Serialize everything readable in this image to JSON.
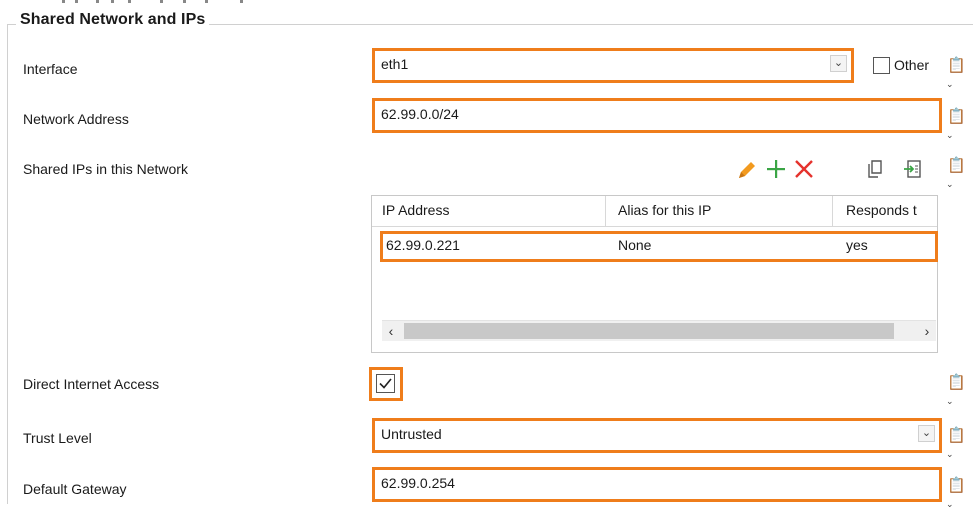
{
  "group_title": "Shared Network and IPs",
  "interface": {
    "label": "Interface",
    "value": "eth1",
    "other_label": "Other"
  },
  "network_address": {
    "label": "Network Address",
    "value": "62.99.0.0/24"
  },
  "shared_ips": {
    "label": "Shared IPs in this Network",
    "columns": [
      "IP Address",
      "Alias for this IP",
      "Responds t"
    ],
    "rows": [
      {
        "ip": "62.99.0.221",
        "alias": "None",
        "responds": "yes"
      }
    ]
  },
  "direct_internet": {
    "label": "Direct Internet Access",
    "checked": true
  },
  "trust_level": {
    "label": "Trust Level",
    "value": "Untrusted"
  },
  "default_gateway": {
    "label": "Default Gateway",
    "value": "62.99.0.254"
  },
  "icons": {
    "side": "clipboard-icon",
    "toolbar": [
      "pencil-icon",
      "plus-icon",
      "delete-icon",
      "copy-icon",
      "import-icon"
    ]
  },
  "colors": {
    "highlight": "#ef7d1b",
    "add_green": "#3aa545",
    "delete_red": "#e5322d",
    "edit_orange": "#f29a1f"
  }
}
